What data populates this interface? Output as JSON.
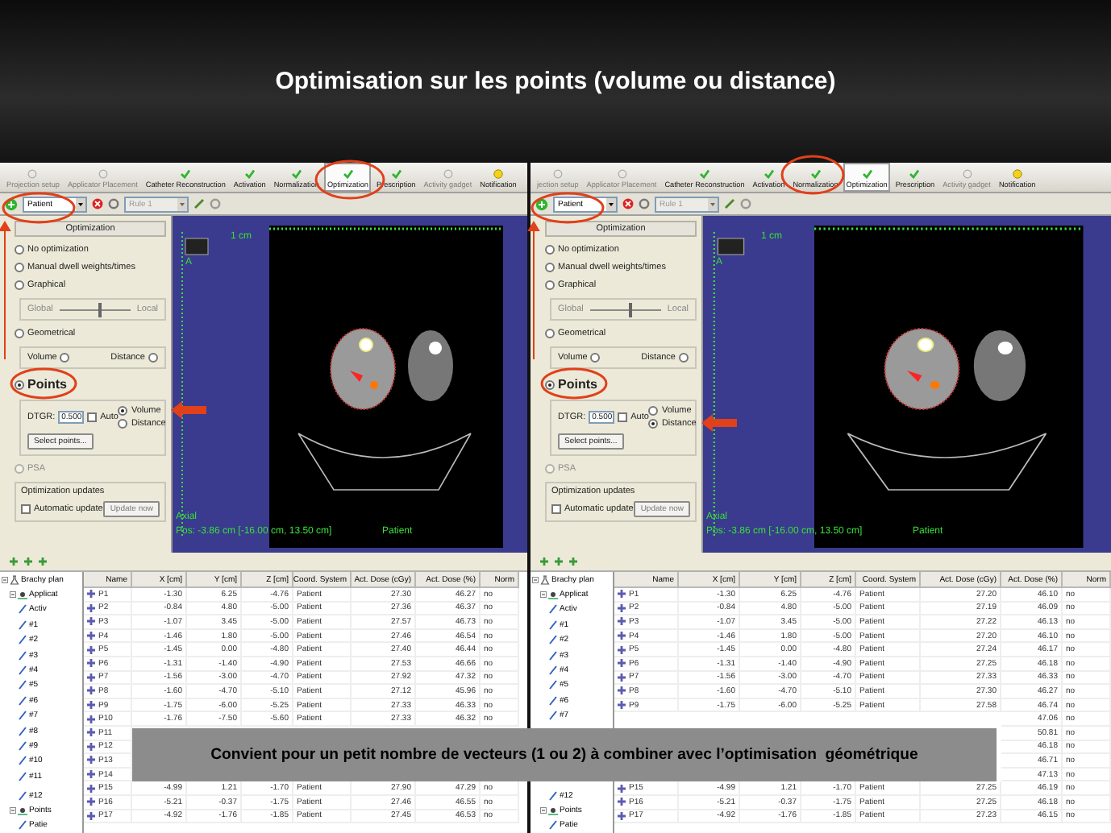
{
  "title": "Optimisation sur les points (volume ou distance)",
  "screens": [
    {
      "toolbar": [
        {
          "kind": "step",
          "label": "Projection setup",
          "disabled": true,
          "selected": false
        },
        {
          "kind": "step",
          "label": "Applicator Placement",
          "disabled": true,
          "selected": false
        },
        {
          "kind": "step",
          "label": "Catheter Reconstruction",
          "disabled": false,
          "selected": false
        },
        {
          "kind": "step",
          "label": "Activation",
          "disabled": false,
          "selected": false
        },
        {
          "kind": "step",
          "label": "Normalization",
          "disabled": false,
          "selected": false
        },
        {
          "kind": "step",
          "label": "Optimization",
          "disabled": false,
          "selected": true
        },
        {
          "kind": "step",
          "label": "Prescription",
          "disabled": false,
          "selected": false
        },
        {
          "kind": "step",
          "label": "Activity gadget",
          "disabled": true,
          "selected": false
        },
        {
          "kind": "alert",
          "label": "Notification",
          "disabled": false,
          "selected": false
        }
      ],
      "patient_combo": "Patient",
      "rule_combo": "Rule 1",
      "panel": {
        "heading": "Optimization",
        "items": [
          {
            "kind": "radio",
            "label": "No optimization",
            "selected": false,
            "disabled": false
          },
          {
            "kind": "radio",
            "label": "Manual dwell weights/times",
            "selected": false,
            "disabled": false
          },
          {
            "kind": "radio",
            "label": "Graphical",
            "selected": false,
            "disabled": false
          },
          {
            "kind": "slider",
            "left": "Global",
            "right": "Local",
            "level": 0.55
          },
          {
            "kind": "radio",
            "label": "Geometrical",
            "selected": false,
            "disabled": false
          },
          {
            "kind": "pair",
            "options": [
              {
                "label": "Volume",
                "selected": false
              },
              {
                "label": "Distance",
                "selected": false
              }
            ]
          },
          {
            "kind": "radio",
            "label": "Points",
            "selected": true,
            "disabled": false
          },
          {
            "kind": "points",
            "label": "DTGR:",
            "value": "0.500",
            "auto": {
              "label": "Auto",
              "checked": false
            },
            "options": [
              {
                "label": "Volume",
                "selected": true
              },
              {
                "label": "Distance",
                "selected": false
              }
            ],
            "button": "Select points..."
          },
          {
            "kind": "radio",
            "label": "PSA",
            "selected": false,
            "disabled": true
          },
          {
            "kind": "updates",
            "title": "Optimization updates",
            "check": {
              "label": "Automatic update",
              "checked": false
            },
            "button": "Update now",
            "button_disabled": true
          }
        ]
      },
      "view": {
        "orientation": "A",
        "scale": "1 cm",
        "plane": "Axial",
        "position": "Pos: -3.86 cm [-16.00 cm, 13.50 cm]",
        "reference": "Patient"
      },
      "tree": [
        {
          "label": "Brachy plan",
          "children": [
            {
              "label": "Applicat",
              "children": [
                {
                  "label": "Activ"
                },
                {
                  "label": "#1"
                },
                {
                  "label": "#2"
                },
                {
                  "label": "#3"
                },
                {
                  "label": "#4"
                },
                {
                  "label": "#5"
                },
                {
                  "label": "#6"
                },
                {
                  "label": "#7"
                },
                {
                  "label": "#8"
                },
                {
                  "label": "#9"
                },
                {
                  "label": "#10"
                },
                {
                  "label": "#11"
                },
                {
                  "label": "#12"
                }
              ]
            },
            {
              "label": "Points",
              "children": [
                {
                  "label": "Patie"
                }
              ]
            }
          ]
        }
      ],
      "table": {
        "columns": [
          "Name",
          "X [cm]",
          "Y [cm]",
          "Z [cm]",
          "Coord. System",
          "Act. Dose (cGy)",
          "Act. Dose (%)",
          "Norm"
        ],
        "rows": [
          {
            "cells": [
              "P1",
              "-1.30",
              "6.25",
              "-4.76",
              "Patient",
              "27.30",
              "46.27",
              "no"
            ]
          },
          {
            "cells": [
              "P2",
              "-0.84",
              "4.80",
              "-5.00",
              "Patient",
              "27.36",
              "46.37",
              "no"
            ]
          },
          {
            "cells": [
              "P3",
              "-1.07",
              "3.45",
              "-5.00",
              "Patient",
              "27.57",
              "46.73",
              "no"
            ]
          },
          {
            "cells": [
              "P4",
              "-1.46",
              "1.80",
              "-5.00",
              "Patient",
              "27.46",
              "46.54",
              "no"
            ]
          },
          {
            "cells": [
              "P5",
              "-1.45",
              "0.00",
              "-4.80",
              "Patient",
              "27.40",
              "46.44",
              "no"
            ]
          },
          {
            "cells": [
              "P6",
              "-1.31",
              "-1.40",
              "-4.90",
              "Patient",
              "27.53",
              "46.66",
              "no"
            ]
          },
          {
            "cells": [
              "P7",
              "-1.56",
              "-3.00",
              "-4.70",
              "Patient",
              "27.92",
              "47.32",
              "no"
            ]
          },
          {
            "cells": [
              "P8",
              "-1.60",
              "-4.70",
              "-5.10",
              "Patient",
              "27.12",
              "45.96",
              "no"
            ]
          },
          {
            "cells": [
              "P9",
              "-1.75",
              "-6.00",
              "-5.25",
              "Patient",
              "27.33",
              "46.33",
              "no"
            ]
          },
          {
            "cells": [
              "P10",
              "-1.76",
              "-7.50",
              "-5.60",
              "Patient",
              "27.33",
              "46.32",
              "no"
            ]
          },
          {
            "cells": [
              "P11",
              null,
              null,
              null,
              null,
              null,
              null,
              null
            ]
          },
          {
            "cells": [
              "P12",
              null,
              null,
              null,
              null,
              null,
              null,
              null
            ]
          },
          {
            "cells": [
              "P13",
              null,
              null,
              null,
              null,
              null,
              null,
              null
            ]
          },
          {
            "cells": [
              "P14",
              null,
              null,
              null,
              null,
              null,
              null,
              null
            ]
          },
          {
            "cells": [
              "P15",
              "-4.99",
              "1.21",
              "-1.70",
              "Patient",
              "27.90",
              "47.29",
              "no"
            ]
          },
          {
            "cells": [
              "P16",
              "-5.21",
              "-0.37",
              "-1.75",
              "Patient",
              "27.46",
              "46.55",
              "no"
            ]
          },
          {
            "cells": [
              "P17",
              "-4.92",
              "-1.76",
              "-1.85",
              "Patient",
              "27.45",
              "46.53",
              "no"
            ]
          }
        ]
      }
    },
    {
      "toolbar": [
        {
          "kind": "step",
          "label": "jection setup",
          "disabled": true,
          "selected": false
        },
        {
          "kind": "step",
          "label": "Applicator Placement",
          "disabled": true,
          "selected": false
        },
        {
          "kind": "step",
          "label": "Catheter Reconstruction",
          "disabled": false,
          "selected": false
        },
        {
          "kind": "step",
          "label": "Activation",
          "disabled": false,
          "selected": false
        },
        {
          "kind": "step",
          "label": "Normalization",
          "disabled": false,
          "selected": false
        },
        {
          "kind": "step",
          "label": "Optimization",
          "disabled": false,
          "selected": true
        },
        {
          "kind": "step",
          "label": "Prescription",
          "disabled": false,
          "selected": false
        },
        {
          "kind": "step",
          "label": "Activity gadget",
          "disabled": true,
          "selected": false
        },
        {
          "kind": "alert",
          "label": "Notification",
          "disabled": false,
          "selected": false
        }
      ],
      "patient_combo": "Patient",
      "rule_combo": "Rule 1",
      "panel": {
        "heading": "Optimization",
        "items": [
          {
            "kind": "radio",
            "label": "No optimization",
            "selected": false,
            "disabled": false
          },
          {
            "kind": "radio",
            "label": "Manual dwell weights/times",
            "selected": false,
            "disabled": false
          },
          {
            "kind": "radio",
            "label": "Graphical",
            "selected": false,
            "disabled": false
          },
          {
            "kind": "slider",
            "left": "Global",
            "right": "Local",
            "level": 0.55
          },
          {
            "kind": "radio",
            "label": "Geometrical",
            "selected": false,
            "disabled": false
          },
          {
            "kind": "pair",
            "options": [
              {
                "label": "Volume",
                "selected": false
              },
              {
                "label": "Distance",
                "selected": false
              }
            ]
          },
          {
            "kind": "radio",
            "label": "Points",
            "selected": true,
            "disabled": false
          },
          {
            "kind": "points",
            "label": "DTGR:",
            "value": "0.500",
            "auto": {
              "label": "Auto",
              "checked": false
            },
            "options": [
              {
                "label": "Volume",
                "selected": false
              },
              {
                "label": "Distance",
                "selected": true
              }
            ],
            "button": "Select points..."
          },
          {
            "kind": "radio",
            "label": "PSA",
            "selected": false,
            "disabled": true
          },
          {
            "kind": "updates",
            "title": "Optimization updates",
            "check": {
              "label": "Automatic update",
              "checked": false
            },
            "button": "Update now",
            "button_disabled": true
          }
        ]
      },
      "view": {
        "orientation": "A",
        "scale": "1 cm",
        "plane": "Axial",
        "position": "Pos: -3.86 cm [-16.00 cm, 13.50 cm]",
        "reference": "Patient"
      },
      "tree": [
        {
          "label": "Brachy plan",
          "children": [
            {
              "label": "Applicat",
              "children": [
                {
                  "label": "Activ"
                },
                {
                  "label": "#1"
                },
                {
                  "label": "#2"
                },
                {
                  "label": "#3"
                },
                {
                  "label": "#4"
                },
                {
                  "label": "#5"
                },
                {
                  "label": "#6"
                },
                {
                  "label": "#7"
                },
                {
                  "label": "#12"
                }
              ]
            },
            {
              "label": "Points",
              "children": [
                {
                  "label": "Patie"
                }
              ]
            }
          ]
        }
      ],
      "table": {
        "columns": [
          "Name",
          "X [cm]",
          "Y [cm]",
          "Z [cm]",
          "Coord. System",
          "Act. Dose (cGy)",
          "Act. Dose (%)",
          "Norm"
        ],
        "rows": [
          {
            "cells": [
              "P1",
              "-1.30",
              "6.25",
              "-4.76",
              "Patient",
              "27.20",
              "46.10",
              "no"
            ]
          },
          {
            "cells": [
              "P2",
              "-0.84",
              "4.80",
              "-5.00",
              "Patient",
              "27.19",
              "46.09",
              "no"
            ]
          },
          {
            "cells": [
              "P3",
              "-1.07",
              "3.45",
              "-5.00",
              "Patient",
              "27.22",
              "46.13",
              "no"
            ]
          },
          {
            "cells": [
              "P4",
              "-1.46",
              "1.80",
              "-5.00",
              "Patient",
              "27.20",
              "46.10",
              "no"
            ]
          },
          {
            "cells": [
              "P5",
              "-1.45",
              "0.00",
              "-4.80",
              "Patient",
              "27.24",
              "46.17",
              "no"
            ]
          },
          {
            "cells": [
              "P6",
              "-1.31",
              "-1.40",
              "-4.90",
              "Patient",
              "27.25",
              "46.18",
              "no"
            ]
          },
          {
            "cells": [
              "P7",
              "-1.56",
              "-3.00",
              "-4.70",
              "Patient",
              "27.33",
              "46.33",
              "no"
            ]
          },
          {
            "cells": [
              "P8",
              "-1.60",
              "-4.70",
              "-5.10",
              "Patient",
              "27.30",
              "46.27",
              "no"
            ]
          },
          {
            "cells": [
              "P9",
              "-1.75",
              "-6.00",
              "-5.25",
              "Patient",
              "27.58",
              "46.74",
              "no"
            ]
          },
          {
            "cells": [
              null,
              null,
              null,
              null,
              null,
              null,
              "47.06",
              "no"
            ]
          },
          {
            "cells": [
              null,
              null,
              null,
              null,
              null,
              null,
              "50.81",
              "no"
            ]
          },
          {
            "cells": [
              null,
              null,
              null,
              null,
              null,
              null,
              "46.18",
              "no"
            ]
          },
          {
            "cells": [
              null,
              null,
              null,
              null,
              null,
              null,
              "46.71",
              "no"
            ]
          },
          {
            "cells": [
              null,
              null,
              null,
              null,
              null,
              null,
              "47.13",
              "no"
            ]
          },
          {
            "cells": [
              "P15",
              "-4.99",
              "1.21",
              "-1.70",
              "Patient",
              "27.25",
              "46.19",
              "no"
            ]
          },
          {
            "cells": [
              "P16",
              "-5.21",
              "-0.37",
              "-1.75",
              "Patient",
              "27.25",
              "46.18",
              "no"
            ]
          },
          {
            "cells": [
              "P17",
              "-4.92",
              "-1.76",
              "-1.85",
              "Patient",
              "27.23",
              "46.15",
              "no"
            ]
          }
        ]
      }
    }
  ],
  "caption": "Convient pour un petit nombre de vecteurs (1 ou 2) à combiner avec l’optimisation  géométrique"
}
